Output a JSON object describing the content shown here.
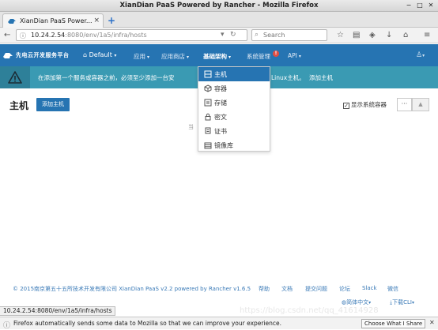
{
  "window": {
    "title": "XianDian PaaS Powered by Rancher - Mozilla Firefox"
  },
  "tab": {
    "label": "XianDian PaaS Power..."
  },
  "url": {
    "host": "10.24.2.54",
    "rest": ":8080/env/1a5/infra/hosts"
  },
  "search": {
    "placeholder": "Search"
  },
  "app": {
    "logo_text": "先电云开发服务平台",
    "env": "Default",
    "nav": [
      {
        "label": "应用"
      },
      {
        "label": "应用商店"
      },
      {
        "label": "基础架构"
      },
      {
        "label": "系统管理"
      },
      {
        "label": "API"
      }
    ]
  },
  "banner": {
    "message": "在添加第一个服务或容器之前，必须至少添加一台安",
    "message_tail": "Linux主机。",
    "link": "添加主机"
  },
  "page": {
    "title": "主机",
    "add_host": "添加主机",
    "show_system": "显示系统容器",
    "more": "···",
    "empty_fragment": "当"
  },
  "dropdown": {
    "items": [
      {
        "label": "主机",
        "icon": "host-icon"
      },
      {
        "label": "容器",
        "icon": "container-icon"
      },
      {
        "label": "存储",
        "icon": "storage-icon"
      },
      {
        "label": "密文",
        "icon": "lock-icon"
      },
      {
        "label": "证书",
        "icon": "certificate-icon"
      },
      {
        "label": "镜像库",
        "icon": "registry-icon"
      }
    ]
  },
  "footer": {
    "copyright": "© 2015南京第五十五所技术开发有限公司 XianDian PaaS v2.2 powered by Rancher v1.6.5",
    "links": [
      "帮助",
      "文档",
      "提交问题",
      "论坛",
      "Slack",
      "微信"
    ],
    "language": "简体中文",
    "download": "下载CLI"
  },
  "status_url": "10.24.2.54:8080/env/1a5/infra/hosts",
  "watermark": "https://blog.csdn.net/qq_41614928",
  "notification": {
    "message": "Firefox automatically sends some data to Mozilla so that we can improve your experience.",
    "button": "Choose What I Share"
  },
  "colors": {
    "nav_bg": "#2674b2",
    "banner_bg": "#3a9ab3",
    "link": "#3a7ab7"
  }
}
